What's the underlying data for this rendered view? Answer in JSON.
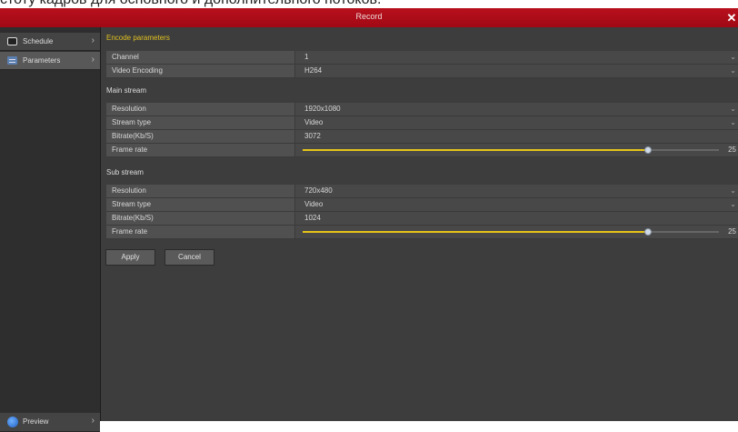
{
  "caption": "стоту кадров для основного и дополнительного потоков.",
  "window": {
    "title": "Record",
    "close_symbol": "✕"
  },
  "sidebar": {
    "items": [
      {
        "label": "Schedule",
        "icon": "schedule-icon"
      },
      {
        "label": "Parameters",
        "icon": "parameters-icon"
      }
    ],
    "bottom": {
      "label": "Preview",
      "icon": "preview-icon"
    }
  },
  "encode": {
    "heading": "Encode parameters",
    "channel": {
      "label": "Channel",
      "value": "1"
    },
    "video_encoding": {
      "label": "Video Encoding",
      "value": "H264"
    }
  },
  "main_stream": {
    "heading": "Main stream",
    "resolution": {
      "label": "Resolution",
      "value": "1920x1080"
    },
    "stream_type": {
      "label": "Stream type",
      "value": "Video"
    },
    "bitrate": {
      "label": "Bitrate(Kb/S)",
      "value": "3072"
    },
    "frame_rate": {
      "label": "Frame rate",
      "value": "25",
      "fraction": 0.83
    }
  },
  "sub_stream": {
    "heading": "Sub stream",
    "resolution": {
      "label": "Resolution",
      "value": "720x480"
    },
    "stream_type": {
      "label": "Stream type",
      "value": "Video"
    },
    "bitrate": {
      "label": "Bitrate(Kb/S)",
      "value": "1024"
    },
    "frame_rate": {
      "label": "Frame rate",
      "value": "25",
      "fraction": 0.83
    }
  },
  "buttons": {
    "apply": "Apply",
    "cancel": "Cancel"
  },
  "colors": {
    "titlebar": "#b30f1c",
    "accent": "#e0c020",
    "slider_fill": "#e6c419"
  },
  "dropdown_symbol": "⌄",
  "chevron_symbol": "›"
}
